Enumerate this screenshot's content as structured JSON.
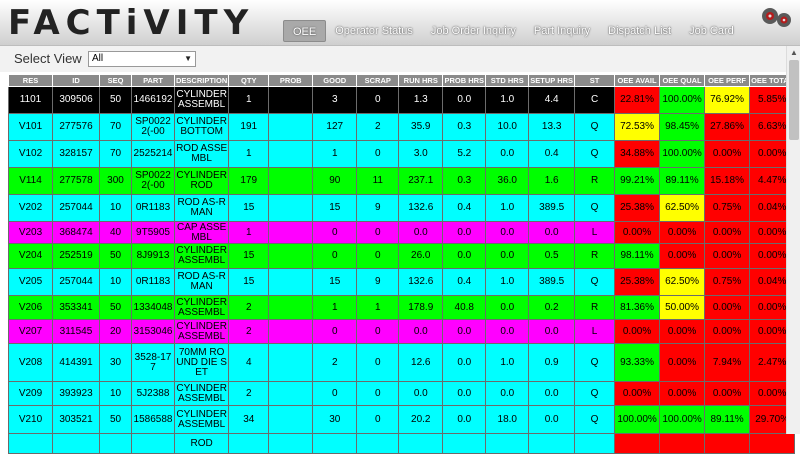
{
  "app": {
    "logo": "FACTiVITY"
  },
  "nav": [
    {
      "label": "OEE",
      "active": true
    },
    {
      "label": "Operator Status",
      "active": false
    },
    {
      "label": "Job Order Inquiry",
      "active": false
    },
    {
      "label": "Part Inquiry",
      "active": false
    },
    {
      "label": "Dispatch List",
      "active": false
    },
    {
      "label": "Job Card",
      "active": false
    }
  ],
  "view_select": {
    "label": "Select View",
    "value": "All"
  },
  "colors": {
    "black": "#000000",
    "cyan": "#00ffff",
    "green": "#00ff00",
    "magenta": "#ff00ff",
    "red": "#ff0000",
    "yellow": "#ffff00"
  },
  "table": {
    "columns": [
      "RES",
      "ID",
      "SEQ",
      "PART",
      "DESCRIPTION",
      "QTY",
      "PROB",
      "GOOD",
      "SCRAP",
      "RUN HRS",
      "PROB HRS",
      "STD HRS",
      "SETUP HRS",
      "ST",
      "OEE AVAIL",
      "OEE QUAL",
      "OEE PERF",
      "OEE TOTAL"
    ],
    "rows": [
      {
        "color": "black",
        "cells": [
          "1101",
          "309506",
          "50",
          "1466192",
          "CYLINDER ASSEMBL",
          "1",
          "",
          "3",
          "0",
          "1.3",
          "0.0",
          "1.0",
          "4.4",
          "C",
          "22.81%",
          "100.00%",
          "76.92%",
          "5.85%"
        ],
        "oee_colors": [
          "red",
          "green",
          "yellow",
          "red"
        ]
      },
      {
        "color": "cyan",
        "cells": [
          "V101",
          "277576",
          "70",
          "SP00222(-00",
          "CYLINDER BOTTOM",
          "191",
          "",
          "127",
          "2",
          "35.9",
          "0.3",
          "10.0",
          "13.3",
          "Q",
          "72.53%",
          "98.45%",
          "27.86%",
          "6.63%"
        ],
        "oee_colors": [
          "yellow",
          "green",
          "red",
          "red"
        ]
      },
      {
        "color": "cyan",
        "cells": [
          "V102",
          "328157",
          "70",
          "2525214",
          "ROD ASSEMBL",
          "1",
          "",
          "1",
          "0",
          "3.0",
          "5.2",
          "0.0",
          "0.4",
          "Q",
          "34.88%",
          "100.00%",
          "0.00%",
          "0.00%"
        ],
        "oee_colors": [
          "red",
          "green",
          "red",
          "red"
        ]
      },
      {
        "color": "green",
        "cells": [
          "V114",
          "277578",
          "300",
          "SP00222(-00",
          "CYLINDER ROD",
          "179",
          "",
          "90",
          "11",
          "237.1",
          "0.3",
          "36.0",
          "1.6",
          "R",
          "99.21%",
          "89.11%",
          "15.18%",
          "4.47%"
        ],
        "oee_colors": [
          "green",
          "green",
          "red",
          "red"
        ]
      },
      {
        "color": "cyan",
        "cells": [
          "V202",
          "257044",
          "10",
          "0R1183",
          "ROD AS-RMAN",
          "15",
          "",
          "15",
          "9",
          "132.6",
          "0.4",
          "1.0",
          "389.5",
          "Q",
          "25.38%",
          "62.50%",
          "0.75%",
          "0.04%"
        ],
        "oee_colors": [
          "red",
          "yellow",
          "red",
          "red"
        ]
      },
      {
        "color": "magenta",
        "cells": [
          "V203",
          "368474",
          "40",
          "9T5905",
          "CAP ASSEMBL",
          "1",
          "",
          "0",
          "0",
          "0.0",
          "0.0",
          "0.0",
          "0.0",
          "L",
          "0.00%",
          "0.00%",
          "0.00%",
          "0.00%"
        ],
        "oee_colors": [
          "red",
          "red",
          "red",
          "red"
        ]
      },
      {
        "color": "green",
        "cells": [
          "V204",
          "252519",
          "50",
          "8J9913",
          "CYLINDER ASSEMBL",
          "15",
          "",
          "0",
          "0",
          "26.0",
          "0.0",
          "0.0",
          "0.5",
          "R",
          "98.11%",
          "0.00%",
          "0.00%",
          "0.00%"
        ],
        "oee_colors": [
          "green",
          "red",
          "red",
          "red"
        ]
      },
      {
        "color": "cyan",
        "cells": [
          "V205",
          "257044",
          "10",
          "0R1183",
          "ROD AS-RMAN",
          "15",
          "",
          "15",
          "9",
          "132.6",
          "0.4",
          "1.0",
          "389.5",
          "Q",
          "25.38%",
          "62.50%",
          "0.75%",
          "0.04%"
        ],
        "oee_colors": [
          "red",
          "yellow",
          "red",
          "red"
        ]
      },
      {
        "color": "green",
        "cells": [
          "V206",
          "353341",
          "50",
          "1334048",
          "CYLINDER ASSEMBL",
          "2",
          "",
          "1",
          "1",
          "178.9",
          "40.8",
          "0.0",
          "0.2",
          "R",
          "81.36%",
          "50.00%",
          "0.00%",
          "0.00%"
        ],
        "oee_colors": [
          "green",
          "yellow",
          "red",
          "red"
        ]
      },
      {
        "color": "magenta",
        "cells": [
          "V207",
          "311545",
          "20",
          "3153046",
          "CYLINDER ASSEMBL",
          "2",
          "",
          "0",
          "0",
          "0.0",
          "0.0",
          "0.0",
          "0.0",
          "L",
          "0.00%",
          "0.00%",
          "0.00%",
          "0.00%"
        ],
        "oee_colors": [
          "red",
          "red",
          "red",
          "red"
        ]
      },
      {
        "color": "cyan",
        "cells": [
          "V208",
          "414391",
          "30",
          "3528-177",
          "70MM ROUND DIE SET",
          "4",
          "",
          "2",
          "0",
          "12.6",
          "0.0",
          "1.0",
          "0.9",
          "Q",
          "93.33%",
          "0.00%",
          "7.94%",
          "2.47%"
        ],
        "oee_colors": [
          "green",
          "red",
          "red",
          "red"
        ]
      },
      {
        "color": "cyan",
        "cells": [
          "V209",
          "393923",
          "10",
          "5J2388",
          "CYLINDER ASSEMBL",
          "2",
          "",
          "0",
          "0",
          "0.0",
          "0.0",
          "0.0",
          "0.0",
          "Q",
          "0.00%",
          "0.00%",
          "0.00%",
          "0.00%"
        ],
        "oee_colors": [
          "red",
          "red",
          "red",
          "red"
        ]
      },
      {
        "color": "cyan",
        "cells": [
          "V210",
          "303521",
          "50",
          "1586588",
          "CYLINDER ASSEMBL",
          "34",
          "",
          "30",
          "0",
          "20.2",
          "0.0",
          "18.0",
          "0.0",
          "Q",
          "100.00%",
          "100.00%",
          "89.11%",
          "29.70%"
        ],
        "oee_colors": [
          "green",
          "green",
          "green",
          "red"
        ]
      },
      {
        "color": "cyan",
        "cells": [
          "",
          "",
          "",
          "",
          "ROD",
          "",
          "",
          "",
          "",
          "",
          "",
          "",
          "",
          "",
          "",
          "",
          "",
          ""
        ],
        "oee_colors": [
          "red",
          "red",
          "red",
          "red"
        ]
      }
    ]
  }
}
